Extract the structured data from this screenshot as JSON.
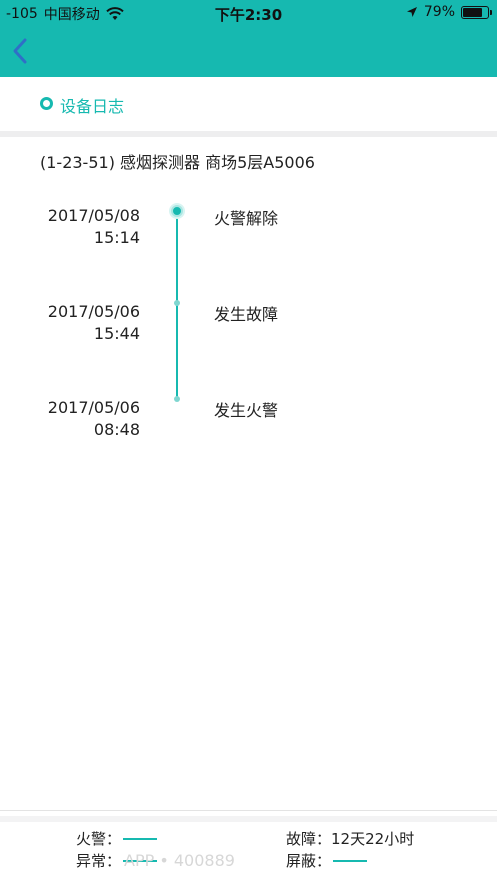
{
  "status_bar": {
    "signal": "-105",
    "carrier": "中国移动",
    "time": "下午2:30",
    "battery": "79%",
    "battery_level": 0.79,
    "icons": [
      "wifi-icon",
      "location-arrow-icon",
      "battery-icon"
    ]
  },
  "nav": {
    "back_icon": "chevron-left-icon"
  },
  "section": {
    "title": "设备日志"
  },
  "device": {
    "label": "(1-23-51) 感烟探测器 商场5层A5006"
  },
  "timeline": [
    {
      "date": "2017/05/08",
      "time": "15:14",
      "event": "火警解除"
    },
    {
      "date": "2017/05/06",
      "time": "15:44",
      "event": "发生故障"
    },
    {
      "date": "2017/05/06",
      "time": "08:48",
      "event": "发生火警"
    }
  ],
  "legend": {
    "fire": "火警：",
    "fault": "故障：",
    "fault_value": "12天22小时",
    "abnormal": "异常：",
    "shield": "屏蔽："
  },
  "watermark": "APP • 400889",
  "colors": {
    "accent": "#16b9b0",
    "divider": "#eeeeef",
    "text": "#222222"
  }
}
